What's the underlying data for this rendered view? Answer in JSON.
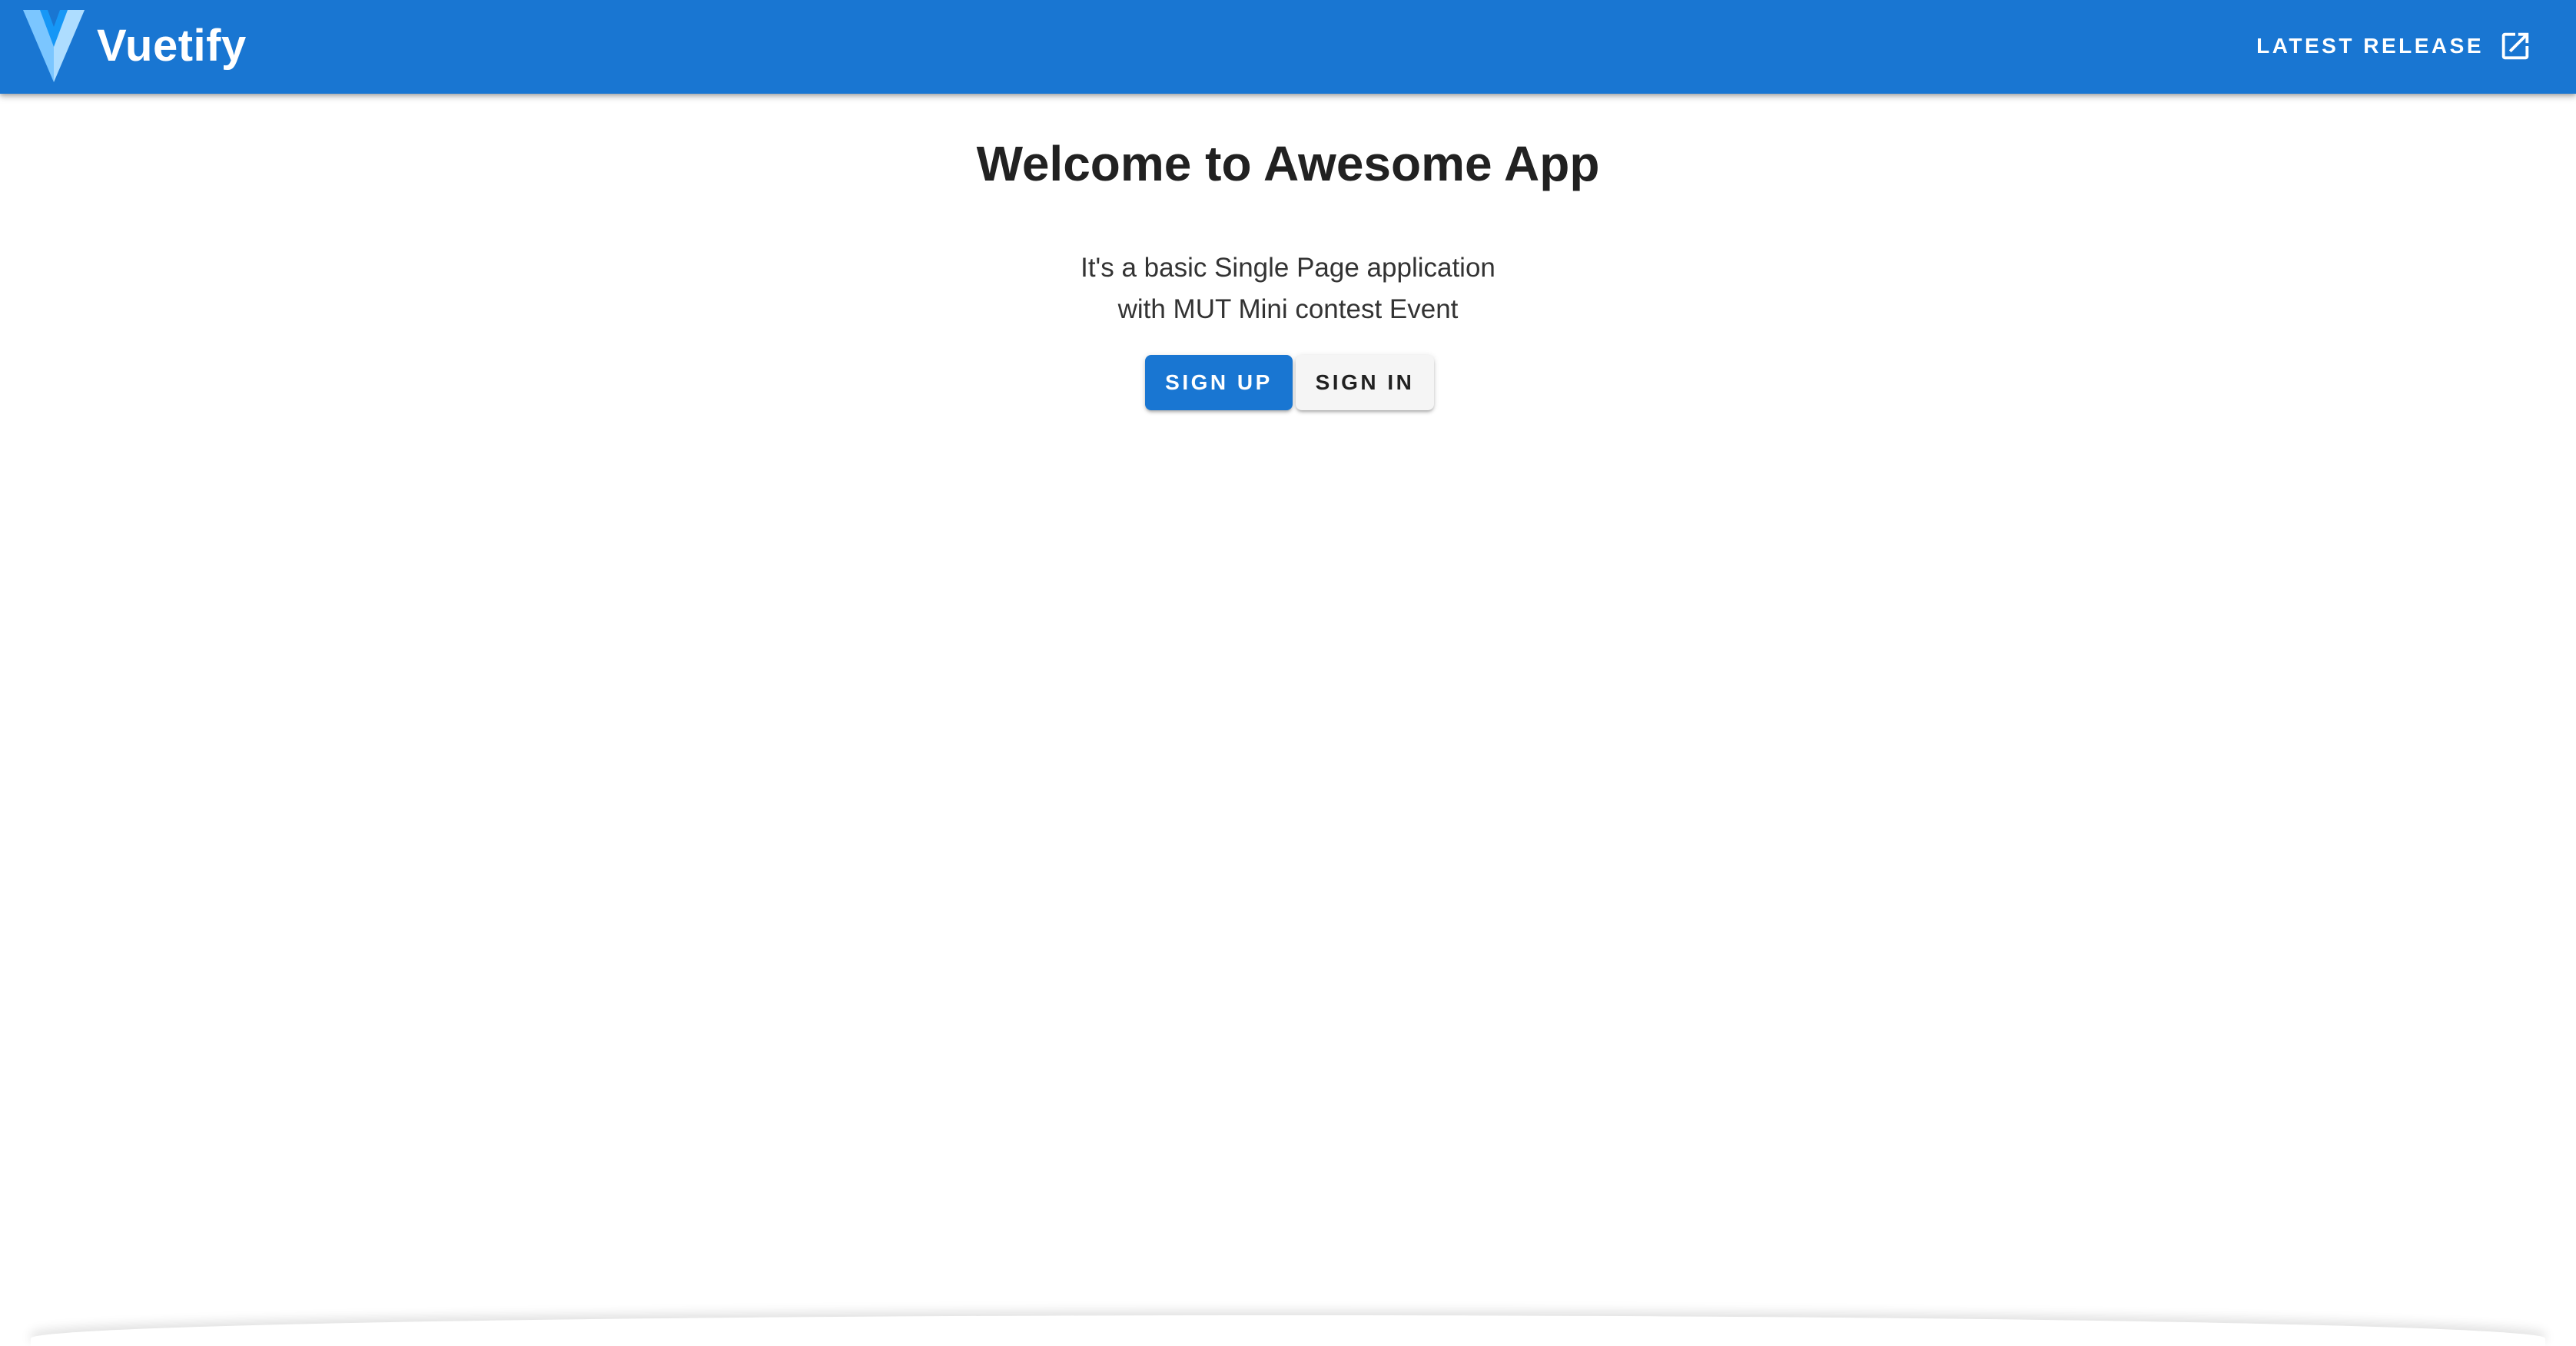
{
  "header": {
    "brand_name": "Vuetify",
    "logo_icon": "vuetify-logo-icon",
    "release_label": "Latest Release",
    "release_icon": "open-in-new-icon"
  },
  "hero": {
    "title": "Welcome to Awesome App",
    "text_line1": "It's a basic Single Page application",
    "text_line2": "with MUT Mini contest Event"
  },
  "actions": {
    "signup_label": "Sign Up",
    "signin_label": "Sign In"
  },
  "colors": {
    "primary": "#1976d2",
    "logo_light": "#aeddff",
    "logo_mid": "#7bc6ff",
    "logo_dark": "#1697f6",
    "title_text": "#212121",
    "secondary_button": "#f5f5f5"
  }
}
